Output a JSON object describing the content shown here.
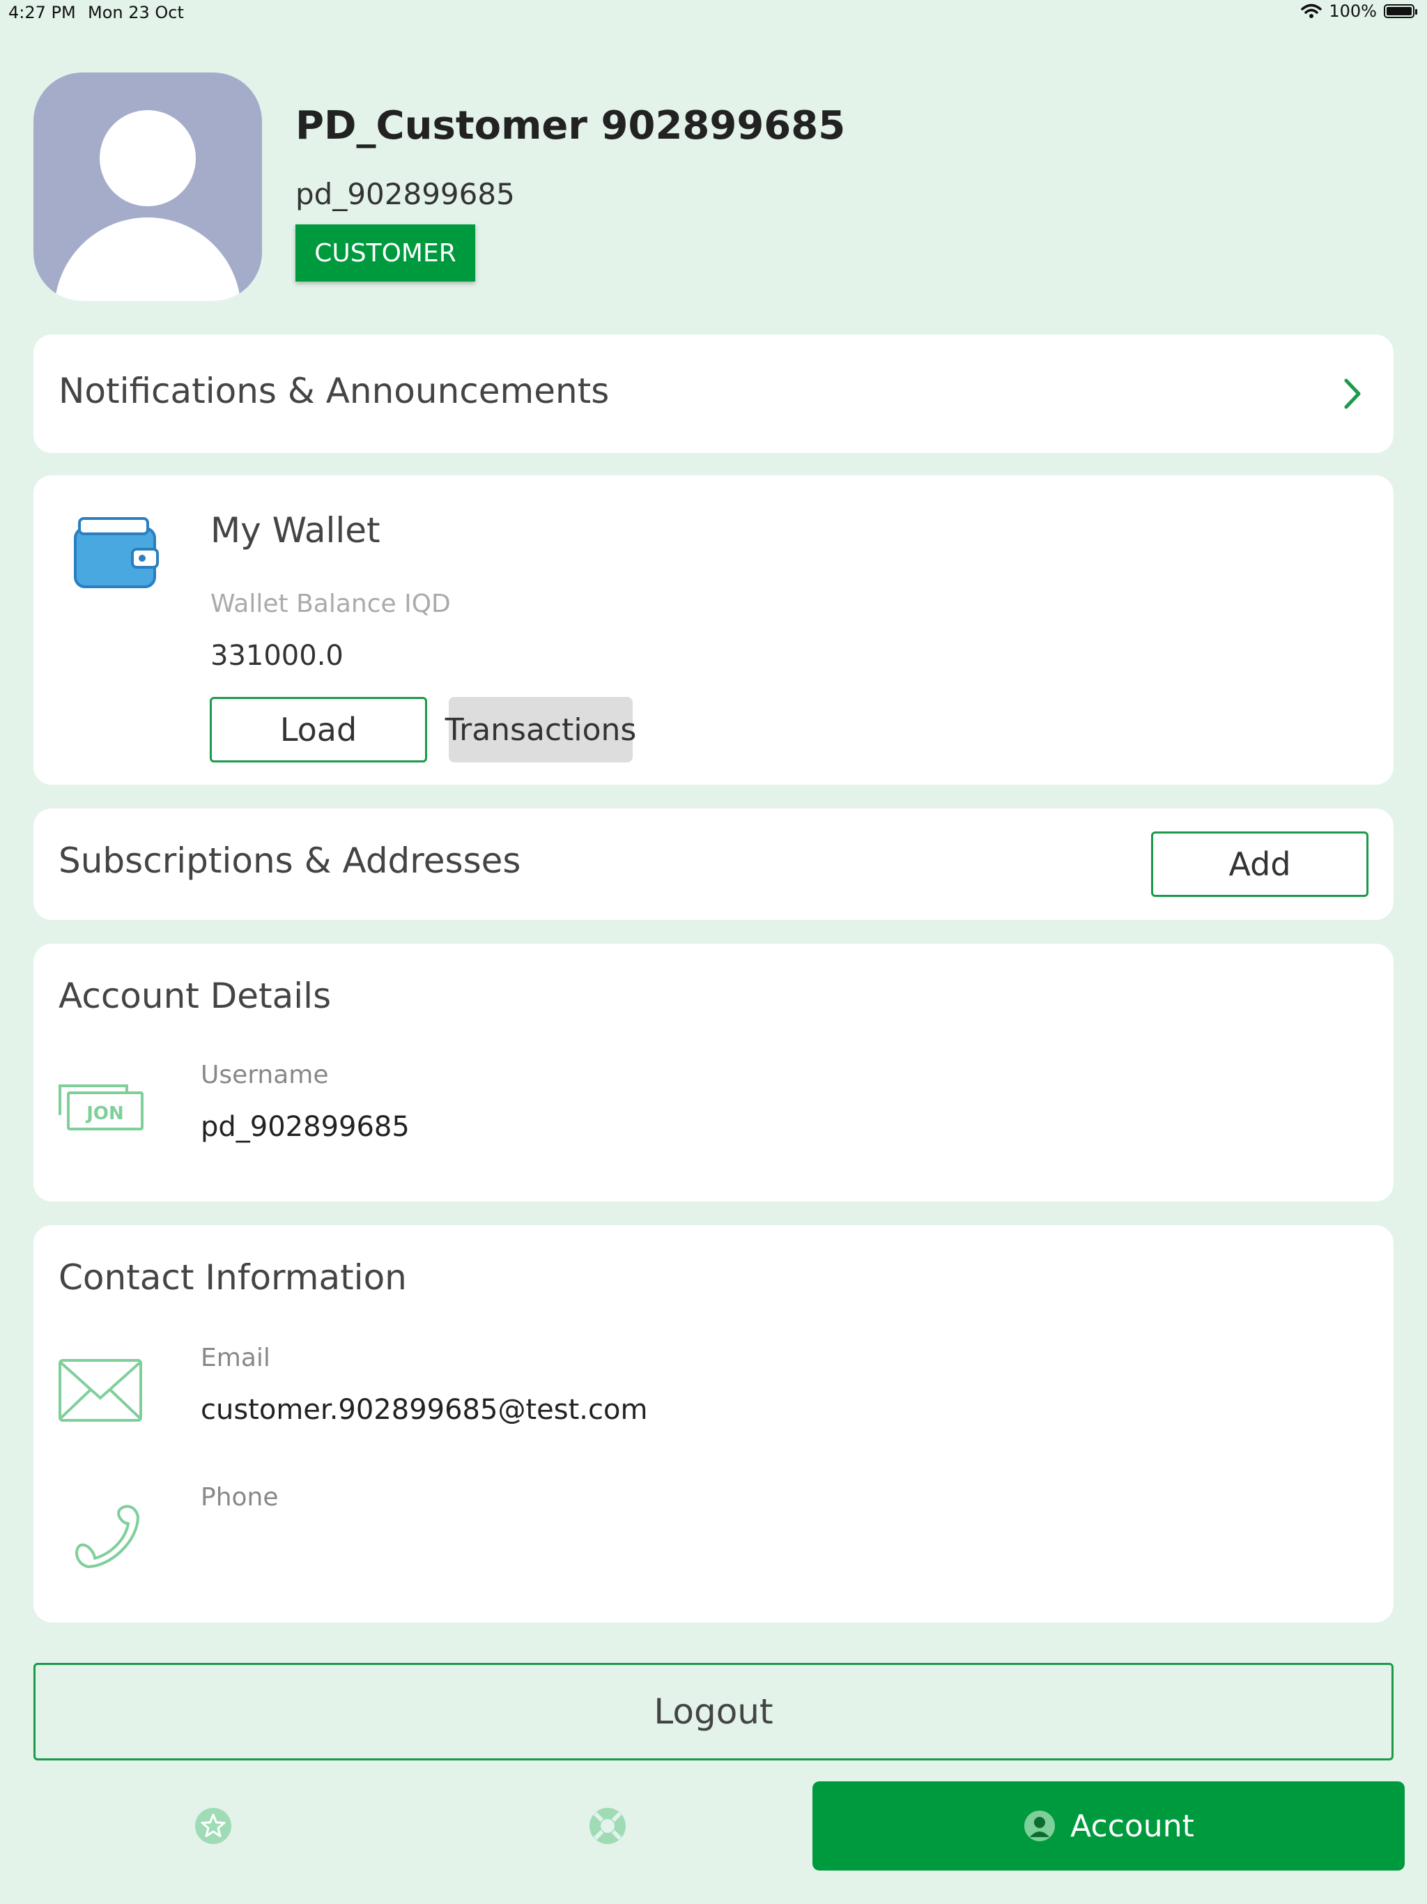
{
  "status_bar": {
    "time": "4:27 PM",
    "date": "Mon 23 Oct",
    "battery": "100%"
  },
  "profile": {
    "name": "PD_Customer 902899685",
    "username": "pd_902899685",
    "role_badge": "CUSTOMER"
  },
  "notifications": {
    "title": "Notifications & Announcements"
  },
  "wallet": {
    "title": "My Wallet",
    "balance_label": "Wallet Balance IQD",
    "balance_value": "331000.0",
    "load_label": "Load",
    "transactions_label": "Transactions"
  },
  "subscriptions": {
    "title": "Subscriptions & Addresses",
    "add_label": "Add"
  },
  "account_details": {
    "title": "Account Details",
    "username_label": "Username",
    "username_value": "pd_902899685",
    "id_icon_text": "JON"
  },
  "contact": {
    "title": "Contact Information",
    "email_label": "Email",
    "email_value": "customer.902899685@test.com",
    "phone_label": "Phone",
    "phone_value": ""
  },
  "logout_label": "Logout",
  "bottom_nav": {
    "account_label": "Account"
  },
  "colors": {
    "background": "#e3f3ea",
    "accent": "#009a3e",
    "wallet_icon": "#4aa8e0",
    "line_icon": "#7fcf9a"
  }
}
